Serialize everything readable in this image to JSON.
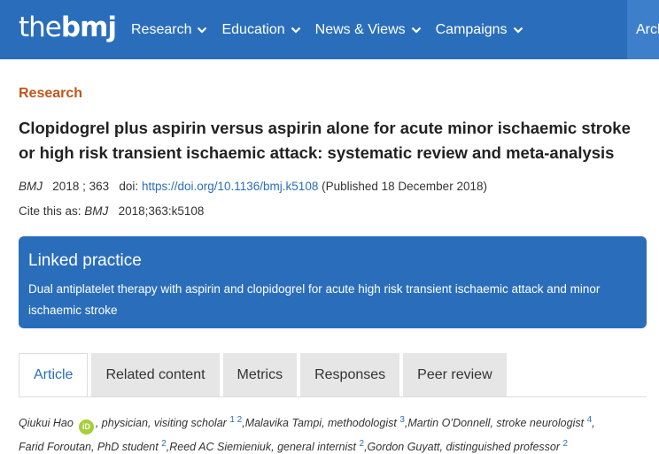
{
  "header": {
    "logo_the": "the",
    "logo_bmj": "bmj",
    "nav": [
      {
        "label": "Research"
      },
      {
        "label": "Education"
      },
      {
        "label": "News & Views"
      },
      {
        "label": "Campaigns"
      }
    ],
    "archive_label": "Arch"
  },
  "article": {
    "section": "Research",
    "title": "Clopidogrel plus aspirin versus aspirin alone for acute minor ischaemic stroke or high risk transient ischaemic attack: systematic review and meta-analysis",
    "journal": "BMJ",
    "year_volume": "2018 ; 363",
    "doi_label": "doi:",
    "doi_url": "https://doi.org/10.1136/bmj.k5108",
    "published": "(Published 18 December 2018)",
    "cite_label": "Cite this as:",
    "cite_journal": "BMJ",
    "cite_ref": "2018;363:k5108"
  },
  "linked_practice": {
    "title": "Linked practice",
    "text": "Dual antiplatelet therapy with aspirin and clopidogrel for acute high risk transient ischaemic attack and minor ischaemic stroke"
  },
  "tabs": [
    {
      "label": "Article"
    },
    {
      "label": "Related content"
    },
    {
      "label": "Metrics"
    },
    {
      "label": "Responses"
    },
    {
      "label": "Peer review"
    }
  ],
  "authors": {
    "a1_name": "Qiukui Hao",
    "orcid": "iD",
    "a1_role": ", physician, visiting scholar",
    "a1_aff": "1 2",
    "a2": ",Malavika Tampi, methodologist",
    "a2_aff": "3",
    "a3": ",Martin O’Donnell, stroke neurologist",
    "a3_aff": "4",
    "a3_end": ",",
    "a4": "Farid Foroutan, PhD student",
    "a4_aff": "2",
    "a5": ",Reed AC Siemieniuk, general internist",
    "a5_aff": "2",
    "a6": ",Gordon Guyatt, distinguished professor",
    "a6_aff": "2"
  },
  "colors": {
    "brand_blue": "#2a6ebb",
    "section_orange": "#c0561b",
    "orcid_green": "#a6ce39"
  }
}
